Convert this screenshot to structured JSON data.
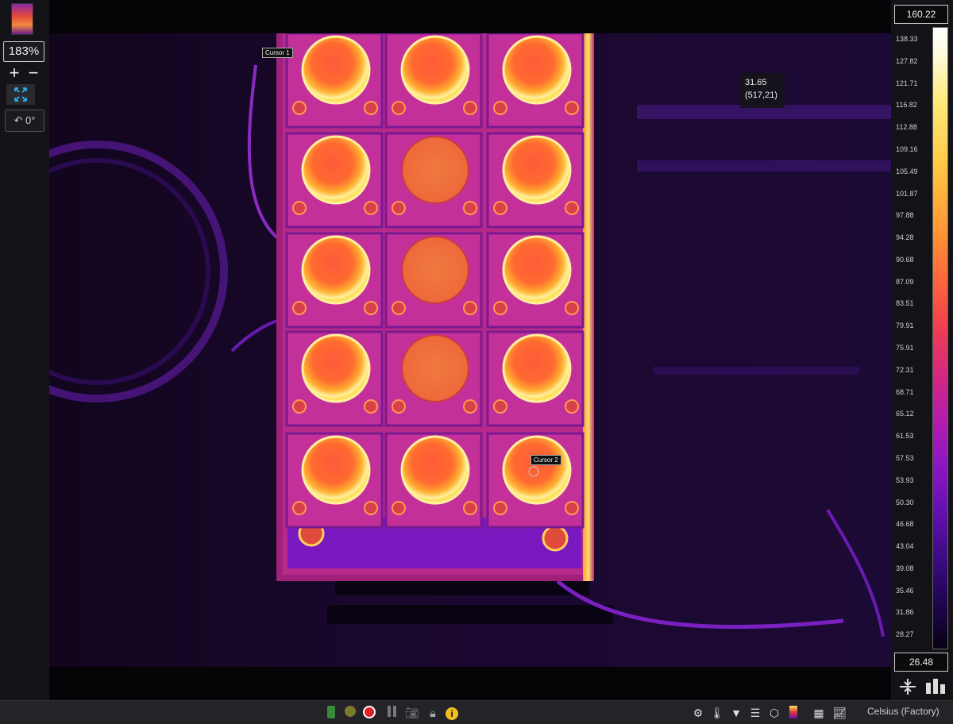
{
  "zoom": {
    "level": "183%"
  },
  "rotation": {
    "label": "0°"
  },
  "palette": {
    "max": "160.22",
    "min": "26.48",
    "ticks": [
      "138.33",
      "127.82",
      "121.71",
      "116.82",
      "112.88",
      "109.16",
      "105.49",
      "101.87",
      "97.88",
      "94.28",
      "90.68",
      "87.09",
      "83.51",
      "79.91",
      "75.91",
      "72.31",
      "68.71",
      "65.12",
      "61.53",
      "57.53",
      "53.93",
      "50.30",
      "46.68",
      "43.04",
      "39.08",
      "35.46",
      "31.86",
      "28.27"
    ]
  },
  "cursors": [
    {
      "label": "Cursor 1"
    },
    {
      "label": "Cursor 2"
    }
  ],
  "readout": {
    "value": "31.65",
    "coords": "(517,21)"
  },
  "status_bar": {
    "unit": "Celsius (Factory)"
  },
  "icons": {
    "zoom_in": "plus-icon",
    "zoom_out": "minus-icon",
    "fit": "fit-to-screen-icon",
    "rotate": "rotate-icon",
    "colors": {
      "accent": "#2aa7e0",
      "record": "#e0202a",
      "info": "#f0c020"
    }
  }
}
